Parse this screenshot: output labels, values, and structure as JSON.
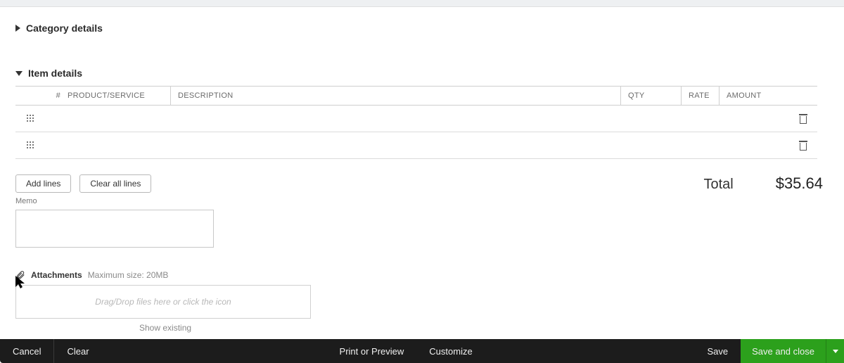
{
  "sections": {
    "category_label": "Category details",
    "items_label": "Item details"
  },
  "table": {
    "headers": {
      "num": "#",
      "product": "PRODUCT/SERVICE",
      "description": "DESCRIPTION",
      "qty": "QTY",
      "rate": "RATE",
      "amount": "AMOUNT"
    }
  },
  "buttons": {
    "add_lines": "Add lines",
    "clear_lines": "Clear all lines"
  },
  "total": {
    "label": "Total",
    "value": "$35.64"
  },
  "memo": {
    "label": "Memo",
    "value": ""
  },
  "attachments": {
    "label": "Attachments",
    "hint": "Maximum size: 20MB",
    "dropzone": "Drag/Drop files here or click the icon",
    "show_existing": "Show existing"
  },
  "footer": {
    "cancel": "Cancel",
    "clear": "Clear",
    "print": "Print or Preview",
    "customize": "Customize",
    "save": "Save",
    "save_close": "Save and close"
  }
}
